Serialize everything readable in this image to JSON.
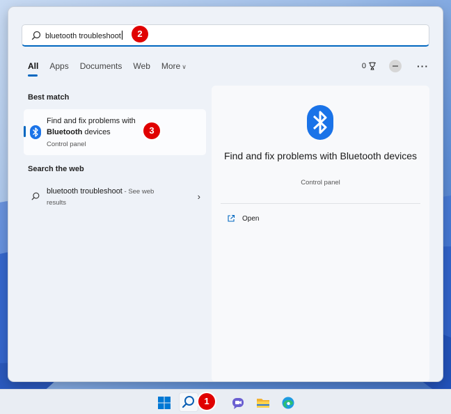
{
  "search": {
    "query": "bluetooth troubleshoot"
  },
  "tabs": [
    {
      "label": "All"
    },
    {
      "label": "Apps"
    },
    {
      "label": "Documents"
    },
    {
      "label": "Web"
    },
    {
      "label": "More"
    }
  ],
  "header_right": {
    "points": "0"
  },
  "best_match": {
    "heading": "Best match",
    "title_line1": "Find and fix problems with",
    "title_bold": "Bluetooth",
    "title_rest": " devices",
    "subtitle": "Control panel"
  },
  "web_search": {
    "heading": "Search the web",
    "query": "bluetooth troubleshoot",
    "suffix": " - See web",
    "suffix_line2": "results"
  },
  "detail": {
    "title": "Find and fix problems with Bluetooth devices",
    "subtitle": "Control panel",
    "action_open": "Open"
  },
  "badges": [
    "1",
    "2",
    "3"
  ],
  "colors": {
    "accent": "#0067c0",
    "bluetooth": "#1a73e8",
    "badge": "#e00000"
  },
  "icons": [
    "search-icon",
    "bluetooth-icon",
    "open-external-icon",
    "windows-start-icon",
    "teams-chat-icon",
    "file-explorer-icon",
    "edge-icon"
  ]
}
